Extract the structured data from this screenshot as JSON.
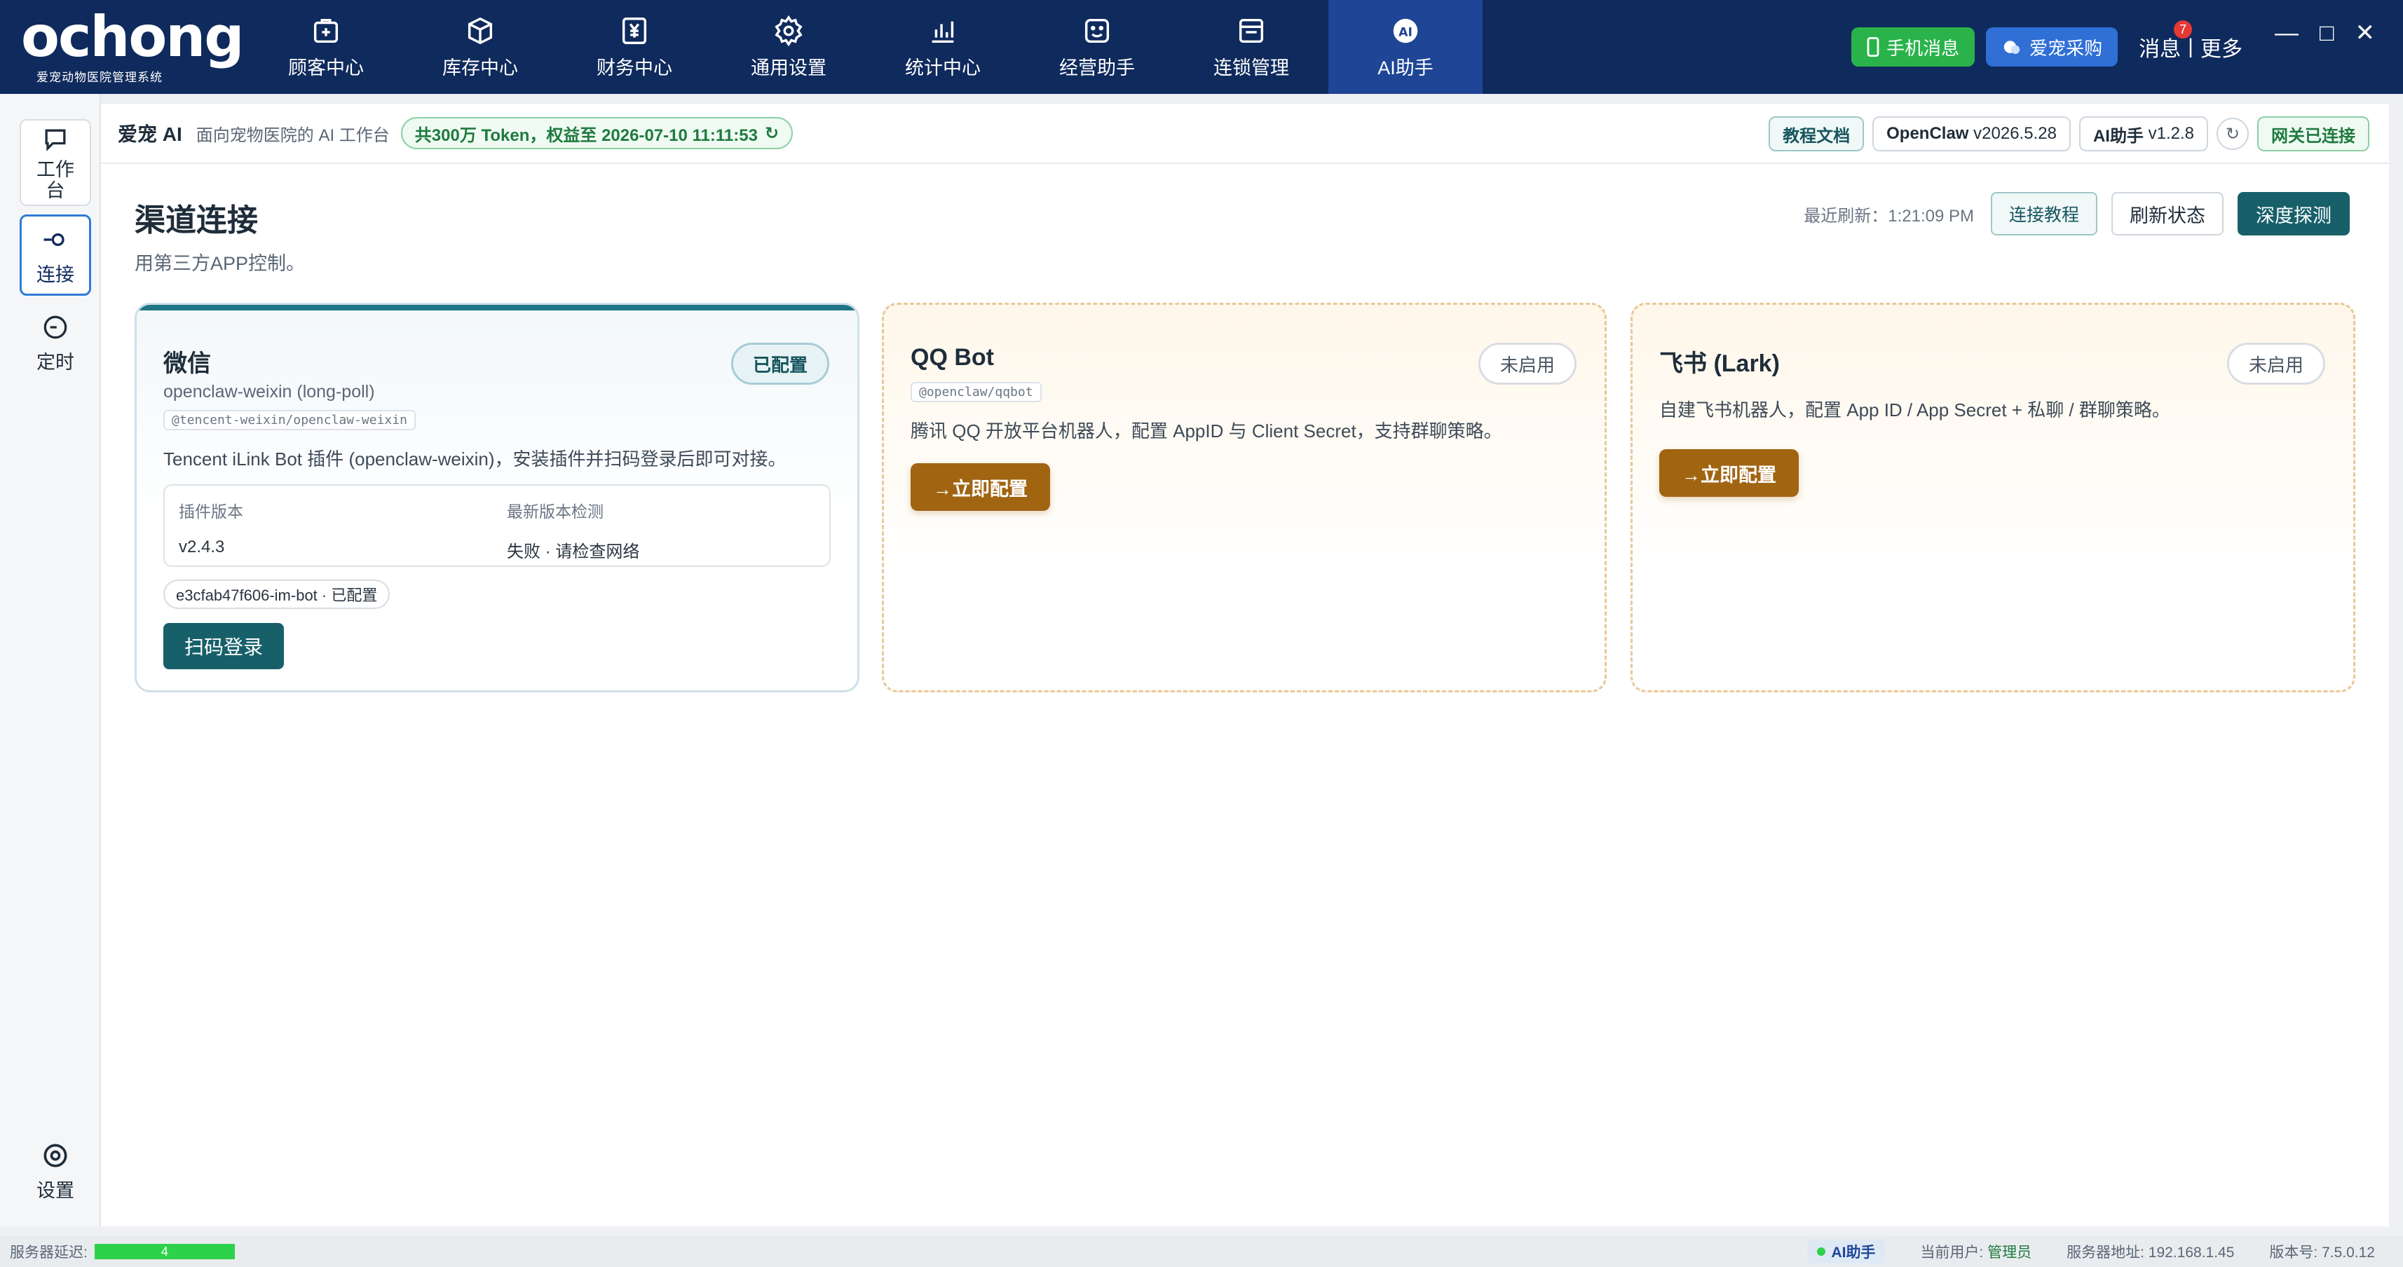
{
  "brand": {
    "logo_text": "ochong",
    "logo_sub": "爱宠动物医院管理系统"
  },
  "nav": [
    {
      "label": "顾客中心",
      "icon": "customer-center-icon"
    },
    {
      "label": "库存中心",
      "icon": "inventory-box-icon"
    },
    {
      "label": "财务中心",
      "icon": "finance-yen-icon"
    },
    {
      "label": "通用设置",
      "icon": "gear-icon"
    },
    {
      "label": "统计中心",
      "icon": "bar-chart-icon"
    },
    {
      "label": "经营助手",
      "icon": "smile-face-icon"
    },
    {
      "label": "连锁管理",
      "icon": "window-icon"
    },
    {
      "label": "AI助手",
      "icon": "ai-badge-icon",
      "active": true
    }
  ],
  "top_right": {
    "mobile_msg": "手机消息",
    "purchase": "爱宠采购",
    "messages": "消息",
    "messages_badge": "7",
    "separator": "|",
    "more": "更多"
  },
  "sidebar": {
    "workbench": "工作台",
    "connect": "连接",
    "schedule": "定时",
    "settings": "设置"
  },
  "subheader": {
    "title": "爱宠 AI",
    "subtitle": "面向宠物医院的 AI 工作台",
    "token_info": "共300万 Token，权益至 2026-07-10 11:11:53",
    "tutorial_docs": "教程文档",
    "openclaw_name": "OpenClaw",
    "openclaw_ver": "v2026.5.28",
    "ai_name": "AI助手",
    "ai_ver": "v1.2.8",
    "gateway": "网关已连接"
  },
  "page": {
    "title": "渠道连接",
    "subtitle": "用第三方APP控制。",
    "last_refresh": "最近刷新：1:21:09 PM",
    "btn_tutorial": "连接教程",
    "btn_refresh": "刷新状态",
    "btn_probe": "深度探测"
  },
  "cards": {
    "weixin": {
      "title": "微信",
      "status": "已配置",
      "plugin": "openclaw-weixin (long-poll)",
      "pkg": "@tencent-weixin/openclaw-weixin",
      "desc": "Tencent iLink Bot 插件 (openclaw-weixin)，安装插件并扫码登录后即可对接。",
      "plugin_ver_label": "插件版本",
      "plugin_ver": "v2.4.3",
      "latest_label": "最新版本检测",
      "latest_value": "失败 · 请检查网络",
      "bot_tag": "e3cfab47f606-im-bot · 已配置",
      "action": "扫码登录"
    },
    "qq": {
      "title": "QQ Bot",
      "status": "未启用",
      "pkg": "@openclaw/qqbot",
      "desc": "腾讯 QQ 开放平台机器人，配置 AppID 与 Client Secret，支持群聊策略。",
      "action": "→立即配置"
    },
    "lark": {
      "title": "飞书 (Lark)",
      "status": "未启用",
      "desc": "自建飞书机器人，配置 App ID / App Secret + 私聊 / 群聊策略。",
      "action": "→立即配置"
    }
  },
  "statusbar": {
    "latency_label": "服务器延迟:",
    "latency_value": "4",
    "ai_tag": "AI助手",
    "user_label": "当前用户:",
    "user_value": "管理员",
    "server_label": "服务器地址: 192.168.1.45",
    "version": "版本号: 7.5.0.12"
  },
  "colors": {
    "nav_bg": "#0f2a5c",
    "nav_active": "#1e4596",
    "primary_teal": "#17606a",
    "action_brown": "#a16411",
    "ok_green": "#1f7a3f"
  }
}
